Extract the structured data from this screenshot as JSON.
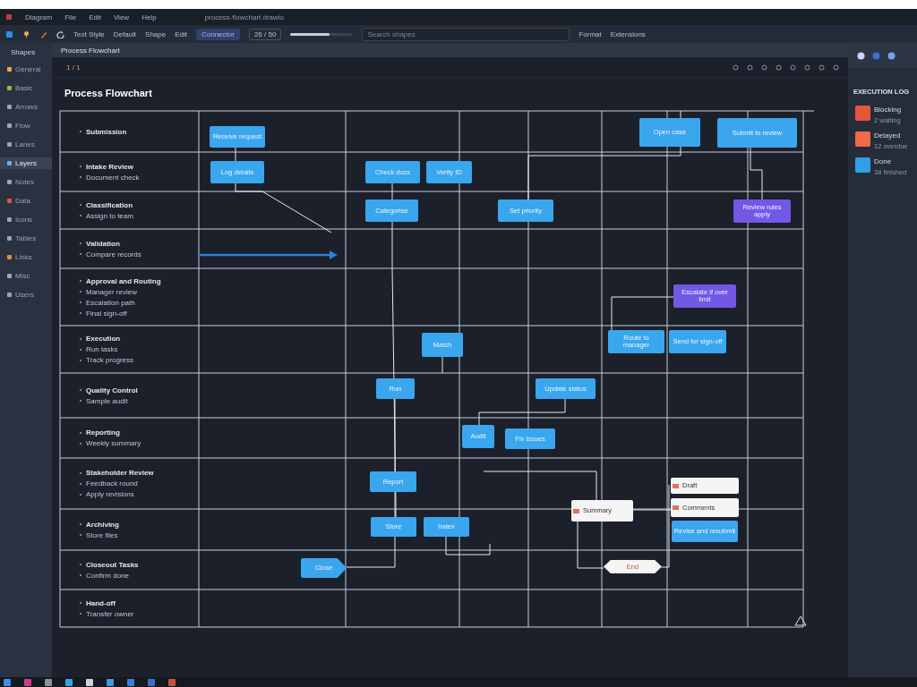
{
  "title_bar": {
    "menus": [
      "Diagram",
      "File",
      "Edit",
      "View",
      "Help"
    ],
    "document": "process-flowchart.drawio"
  },
  "toolbar": {
    "tools": [
      "Text Style",
      "Default",
      "Shape",
      "Edit"
    ],
    "mode": "Connector",
    "page": "26 / 50",
    "slider": {
      "level": 0.62
    },
    "search": {
      "placeholder": "Search shapes"
    },
    "buttons": [
      "Format",
      "Extensions"
    ]
  },
  "sidebar": {
    "title": "Shapes",
    "items": [
      {
        "label": "General",
        "selected": false
      },
      {
        "label": "Basic",
        "selected": false
      },
      {
        "label": "Arrows",
        "selected": false
      },
      {
        "label": "Flow",
        "selected": false
      },
      {
        "label": "Lanes",
        "selected": false
      },
      {
        "label": "Layers",
        "selected": true
      },
      {
        "label": "Notes",
        "selected": false
      },
      {
        "label": "Data",
        "selected": false
      },
      {
        "label": "Icons",
        "selected": false
      },
      {
        "label": "Tables",
        "selected": false
      },
      {
        "label": "Links",
        "selected": false
      },
      {
        "label": "Misc",
        "selected": false
      },
      {
        "label": "Users",
        "selected": false
      }
    ]
  },
  "tabs": [
    {
      "label": "Process Flowchart",
      "selected": true
    }
  ],
  "page_indicator": "1 / 1",
  "diagram": {
    "title": "Process Flowchart",
    "lanes": [
      {
        "title": "Submission"
      },
      {
        "title": "Intake Review",
        "lines": [
          "Document check"
        ]
      },
      {
        "title": "Classification",
        "lines": [
          "Assign to team"
        ]
      },
      {
        "title": "Validation",
        "lines": [
          "Compare records"
        ]
      },
      {
        "title": "Approval and Routing",
        "lines": [
          "Manager review",
          "Escalation path",
          "Final sign-off"
        ]
      },
      {
        "title": "Execution",
        "lines": [
          "Run tasks",
          "Track progress"
        ]
      },
      {
        "title": "Quality Control",
        "lines": [
          "Sample audit"
        ]
      },
      {
        "title": "Reporting",
        "lines": [
          "Weekly summary"
        ]
      },
      {
        "title": "Stakeholder Review",
        "lines": [
          "Feedback round",
          "Apply revisions"
        ]
      },
      {
        "title": "Archiving",
        "lines": [
          "Store files"
        ]
      },
      {
        "title": "Closeout Tasks",
        "lines": [
          "Confirm done"
        ]
      },
      {
        "title": "Hand-off",
        "lines": [
          "Transfer owner"
        ]
      }
    ],
    "nodes": [
      {
        "kind": "process",
        "label": "Receive request"
      },
      {
        "kind": "process",
        "label": "Log details"
      },
      {
        "kind": "process",
        "label": "Check docs"
      },
      {
        "kind": "process",
        "label": "Verify ID"
      },
      {
        "kind": "process",
        "label": "Open case"
      },
      {
        "kind": "process",
        "label": "Submit to review"
      },
      {
        "kind": "process",
        "label": "Categorise"
      },
      {
        "kind": "process",
        "label": "Set priority"
      },
      {
        "kind": "note",
        "label": "Review rules apply"
      },
      {
        "kind": "note",
        "label": "Escalate if over limit"
      },
      {
        "kind": "process",
        "label": "Match"
      },
      {
        "kind": "process",
        "label": "Route to manager"
      },
      {
        "kind": "process",
        "label": "Send for sign-off"
      },
      {
        "kind": "process",
        "label": "Run"
      },
      {
        "kind": "process",
        "label": "Update status"
      },
      {
        "kind": "process",
        "label": "Audit"
      },
      {
        "kind": "process",
        "label": "Fix issues"
      },
      {
        "kind": "process",
        "label": "Report"
      },
      {
        "kind": "document",
        "label": "Summary"
      },
      {
        "kind": "document",
        "label": "Draft"
      },
      {
        "kind": "document",
        "label": "Comments"
      },
      {
        "kind": "process",
        "label": "Revise and resubmit"
      },
      {
        "kind": "process",
        "label": "Store"
      },
      {
        "kind": "process",
        "label": "Index"
      },
      {
        "kind": "flag",
        "label": "Close"
      },
      {
        "kind": "terminal",
        "label": "End"
      }
    ]
  },
  "right_panel": {
    "title": "EXECUTION LOG",
    "items": [
      {
        "title": "Blocking",
        "detail": "2 waiting",
        "color": "#e8553f"
      },
      {
        "title": "Delayed",
        "detail": "12 overdue",
        "color": "#f0694a"
      },
      {
        "title": "Done",
        "detail": "38 finished",
        "color": "#2f9fe6"
      }
    ]
  }
}
